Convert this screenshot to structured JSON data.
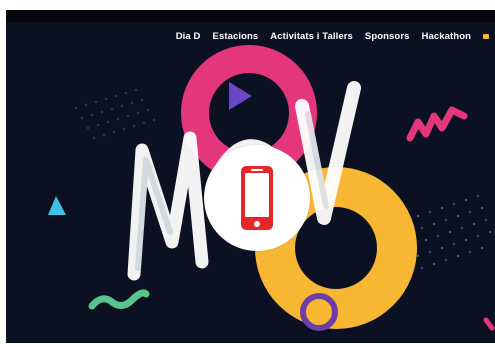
{
  "nav": {
    "items": [
      {
        "id": "dia-d",
        "label": "Dia D"
      },
      {
        "id": "estacions",
        "label": "Estacions"
      },
      {
        "id": "activitats-tallers",
        "label": "Activitats i Tallers"
      },
      {
        "id": "sponsors",
        "label": "Sponsors"
      },
      {
        "id": "hackathon",
        "label": "Hackathon"
      }
    ]
  },
  "hero": {
    "logo_text": "MOV",
    "overlay_icon": "mobile-phone-icon"
  },
  "colors": {
    "background": "#0b1122",
    "pink_ring": "#e4367c",
    "yellow_ring": "#f7b733",
    "purple_ring": "#6d3fa6",
    "cyan_triangle": "#3fc1e6",
    "green_squiggle": "#58c48e",
    "phone_red": "#e5262b"
  }
}
